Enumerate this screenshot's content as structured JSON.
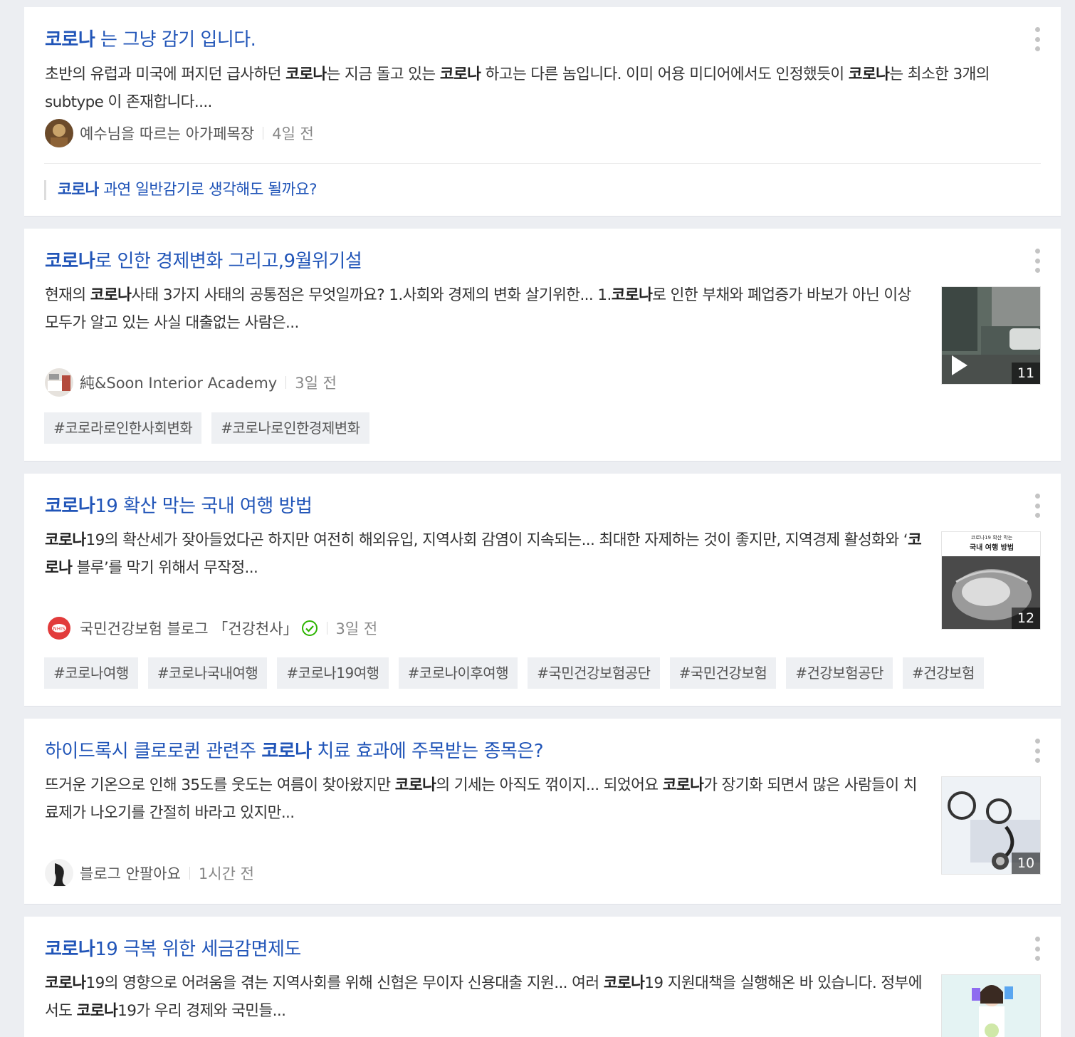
{
  "results": [
    {
      "title": "는 그냥 감기 입니다.",
      "desc_lines": [
        "초반의 유럽과 미국에 퍼지던 급사하던 ",
        "는 지금 돌고 있는 ",
        " 하고는 다른 놈입니다. 이미 어용 미디어에서도 인정했듯이 ",
        "는 최소한 3개의 subtype 이 존재합니다...."
      ],
      "author": "예수님을 따르는 아가페목장",
      "time": "4일 전",
      "related": "과연 일반감기로 생각해도 될까요?"
    },
    {
      "title": "로 인한 경제변화 그리고,9월위기설",
      "desc": [
        "현재의 ",
        "사태 3가지 사태의 공통점은 무엇일까요? 1.사회와 경제의 변화 살기위한... 1.",
        "로 인한 부채와 폐업증가 바보가 아닌 이상 모두가 알고 있는 사실 대출없는 사람은..."
      ],
      "author": "純&Soon Interior Academy",
      "time": "3일 전",
      "thumb_count": "11",
      "tags": [
        "#코로라로인한사회변화",
        "#코로나로인한경제변화"
      ]
    },
    {
      "title": "19 확산 막는 국내 여행 방법",
      "desc": [
        "19의 확산세가 잦아들었다곤 하지만 여전히 해외유입, 지역사회 감염이 지속되는... 최대한 자제하는 것이 좋지만, 지역경제 활성화와 ‘",
        " 블루’를 막기 위해서 무작정..."
      ],
      "author": "국민건강보험 블로그 「건강천사」",
      "time": "3일 전",
      "thumb_count": "12",
      "thumb_caption_top": "코로나19 확산 막는",
      "thumb_caption_main": "국내 여행 방법",
      "tags": [
        "#코로나여행",
        "#코로나국내여행",
        "#코로나19여행",
        "#코로나이후여행",
        "#국민건강보험공단",
        "#국민건강보험",
        "#건강보험공단",
        "#건강보험"
      ]
    },
    {
      "title_pre": "하이드록시 클로로퀸 관련주 ",
      "title_post": " 치료 효과에 주목받는 종목은?",
      "desc": [
        "뜨거운 기온으로 인해 35도를 웃도는 여름이 찾아왔지만 ",
        "의 기세는 아직도 꺾이지... 되었어요 ",
        "가 장기화 되면서 많은 사람들이 치료제가 나오기를 간절히 바라고 있지만..."
      ],
      "author": "블로그 안팔아요",
      "time": "1시간 전",
      "thumb_count": "10"
    },
    {
      "title": "19 극복 위한 세금감면제도",
      "desc": [
        "19의 영향으로 어려움을 겪는 지역사회를 위해 신협은 무이자 신용대출 지원... 여러 ",
        "19 지원대책을 실행해온 바 있습니다. 정부에서도 ",
        "19가 우리 경제와 국민들..."
      ]
    }
  ],
  "keyword": "코로나",
  "accent_color": "#2155b8",
  "verified_color": "#2db400"
}
